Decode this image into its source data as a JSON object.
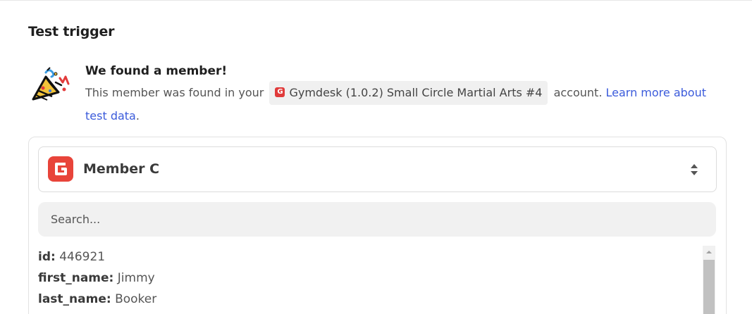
{
  "section": {
    "title": "Test trigger"
  },
  "found": {
    "title": "We found a member!",
    "desc_prefix": "This member was found in your",
    "app_chip_label": "Gymdesk (1.0.2) Small Circle Martial Arts #4",
    "desc_suffix": "account.",
    "learn_more_link": "Learn more about test data",
    "period": "."
  },
  "selector": {
    "label": "Member C",
    "logo_icon": "gymdesk-logo-icon",
    "toggle_icon": "updown-chevron-icon"
  },
  "search": {
    "placeholder": "Search...",
    "value": ""
  },
  "fields": [
    {
      "key": "id:",
      "value": "446921"
    },
    {
      "key": "first_name:",
      "value": "Jimmy"
    },
    {
      "key": "last_name:",
      "value": "Booker"
    }
  ],
  "colors": {
    "link": "#3b5bdb",
    "brand_red": "#e8443a",
    "chip_bg": "#f0f0f0",
    "search_bg": "#f1f1f1"
  }
}
